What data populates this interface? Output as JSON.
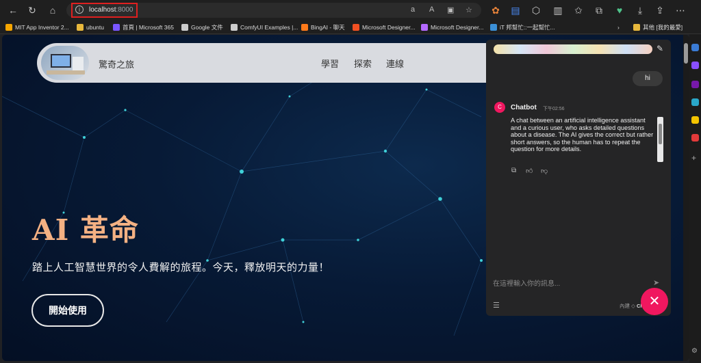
{
  "browser": {
    "address": {
      "host": "localhost",
      "port": ":8000"
    },
    "bookmarks": [
      {
        "label": "MIT App Inventor 2...",
        "color": "#f7a600"
      },
      {
        "label": "ubuntu",
        "color": "#e8b83c"
      },
      {
        "label": "首頁 | Microsoft 365",
        "color": "#7a56ff"
      },
      {
        "label": "Google 文件",
        "color": "#cccccc"
      },
      {
        "label": "ComfyUI Examples |...",
        "color": "#cccccc"
      },
      {
        "label": "BingAI - 聊天",
        "color": "#ff7a1a"
      },
      {
        "label": "Microsoft Designer...",
        "color": "#f25022"
      },
      {
        "label": "Microsoft Designer...",
        "color": "#b469ff"
      },
      {
        "label": "iT 邦幫忙::一起幫忙...",
        "color": "#3b8fd6"
      }
    ],
    "bookmarks_other": "其他 [我的最愛]"
  },
  "site": {
    "brand": "驚奇之旅",
    "nav": [
      "學習",
      "探索",
      "連線"
    ],
    "hero_title": "AI 革命",
    "hero_subtitle": "踏上人工智慧世界的令人費解的旅程。今天，釋放明天的力量！",
    "cta_label": "開始使用"
  },
  "chat": {
    "user_message": "hi",
    "bot": {
      "avatar_letter": "C",
      "name": "Chatbot",
      "time": "下午02:56",
      "text": "A chat between an artificial intelligence assistant and a curious user, who asks detailed questions about a disease. The AI gives the correct but rather short answers, so the human has to repeat the question for more details."
    },
    "input_placeholder": "在這裡輸入你的訊息...",
    "built_with_prefix": "內建",
    "built_with_brand": "Chainlit"
  },
  "colors": {
    "accent": "#f0175f",
    "hero_title": "#f4b183"
  }
}
